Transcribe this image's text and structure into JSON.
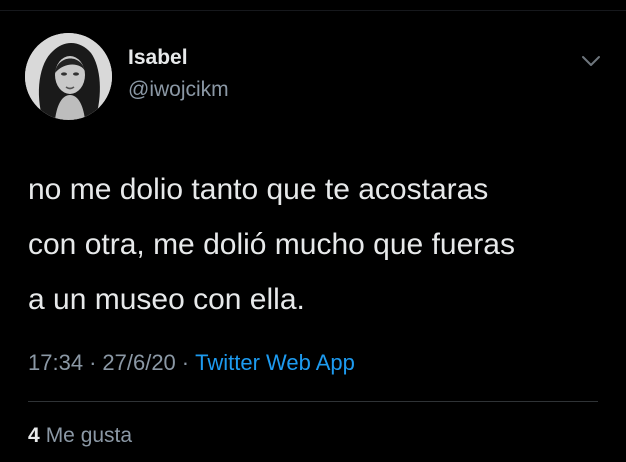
{
  "user": {
    "name": "Isabel",
    "handle": "@iwojcikm",
    "avatar": "profile-photo-grayscale"
  },
  "tweet": {
    "text": "no me dolio tanto que te acostaras\ncon otra, me dolió mucho que fueras\na un museo con ella."
  },
  "meta": {
    "time": "17:34",
    "separator": "·",
    "date": "27/6/20",
    "source": "Twitter Web App"
  },
  "likes": {
    "count": "4",
    "label": "Me gusta"
  },
  "icons": {
    "menu": "chevron-down-icon"
  },
  "colors": {
    "background": "#000000",
    "text": "#e7e9ea",
    "secondary": "#8b98a5",
    "link": "#1d9bf0",
    "divider": "#2f3336"
  }
}
